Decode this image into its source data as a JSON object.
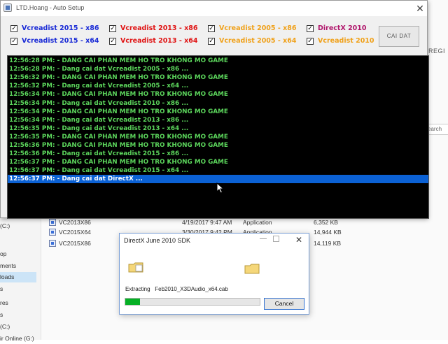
{
  "window": {
    "title": "LTD.Hoang - Auto Setup",
    "close_glyph": "✕"
  },
  "checkboxes": [
    {
      "label": "Vcreadist 2015 - x86",
      "checked": true,
      "color": "#1a2bd6"
    },
    {
      "label": "Vcreadist 2015 - x64",
      "checked": true,
      "color": "#1a2bd6"
    },
    {
      "label": "Vcreadist 2013 - x86",
      "checked": true,
      "color": "#e01515"
    },
    {
      "label": "Vcreadist 2013 - x64",
      "checked": true,
      "color": "#e01515"
    },
    {
      "label": "Vcreadist 2005 - x86",
      "checked": true,
      "color": "#f0a11a"
    },
    {
      "label": "Vcreadist 2005 - x64",
      "checked": true,
      "color": "#f0a11a"
    },
    {
      "label": "DirectX 2010",
      "checked": true,
      "color": "#b0156b"
    },
    {
      "label": "Vcreadist 2010",
      "checked": true,
      "color": "#f0a11a"
    }
  ],
  "install_button": "CAI DAT",
  "log": [
    "12:56:28 PM: - DANG CAI PHAN MEM HO TRO KHONG MO GAME",
    "12:56:28 PM: - Dang cai dat Vcreadist 2005 - x86 ...",
    "12:56:32 PM: - DANG CAI PHAN MEM HO TRO KHONG MO GAME",
    "12:56:32 PM: - Dang cai dat Vcreadist 2005 - x64 ...",
    "12:56:34 PM: - DANG CAI PHAN MEM HO TRO KHONG MO GAME",
    "12:56:34 PM: - Dang cai dat Vcreadist 2010 - x86 ...",
    "12:56:34 PM: - DANG CAI PHAN MEM HO TRO KHONG MO GAME",
    "12:56:34 PM: - Dang cai dat Vcreadist 2013 - x86 ...",
    "12:56:35 PM: - Dang cai dat Vcreadist 2013 - x64 ...",
    "12:56:35 PM: - DANG CAI PHAN MEM HO TRO KHONG MO GAME",
    "12:56:36 PM: - DANG CAI PHAN MEM HO TRO KHONG MO GAME",
    "12:56:36 PM: - Dang cai dat Vcreadist 2015 - x86 ...",
    "12:56:37 PM: - DANG CAI PHAN MEM HO TRO KHONG MO GAME",
    "12:56:37 PM: - Dang cai dat Vcreadist 2015 - x64 ...",
    "12:56:37 PM: - Dang cai dat DirectX ..."
  ],
  "log_selected_index": 14,
  "explorer": {
    "nav_items": [
      {
        "label": "(C:)",
        "selected": false
      },
      {
        "label": "op",
        "selected": false
      },
      {
        "label": "ments",
        "selected": false
      },
      {
        "label": "loads",
        "selected": true
      },
      {
        "label": "s",
        "selected": false
      },
      {
        "label": "res",
        "selected": false
      },
      {
        "label": "s",
        "selected": false
      },
      {
        "label": "(C:)",
        "selected": false
      },
      {
        "label": "ir Online (G:)",
        "selected": false
      }
    ],
    "files": [
      {
        "name": "VC2013X86",
        "date": "4/19/2017 9:47 AM",
        "type": "Application",
        "size": "6,352 KB"
      },
      {
        "name": "VC2015X64",
        "date": "3/30/2017 9:42 PM",
        "type": "Application",
        "size": "14,944 KB"
      },
      {
        "name": "VC2015X86",
        "date": "",
        "type": "",
        "size": "14,119 KB"
      }
    ],
    "right_edge_text": "REGI",
    "search_text": "earch"
  },
  "dialog": {
    "title": "DirectX June 2010 SDK",
    "extracting_label": "Extracting",
    "filename": "Feb2010_X3DAudio_x64.cab",
    "progress": 0.11,
    "cancel_label": "Cancel",
    "min_glyph": "—",
    "close_glyph": "✕",
    "progress_color": "#06b025"
  }
}
